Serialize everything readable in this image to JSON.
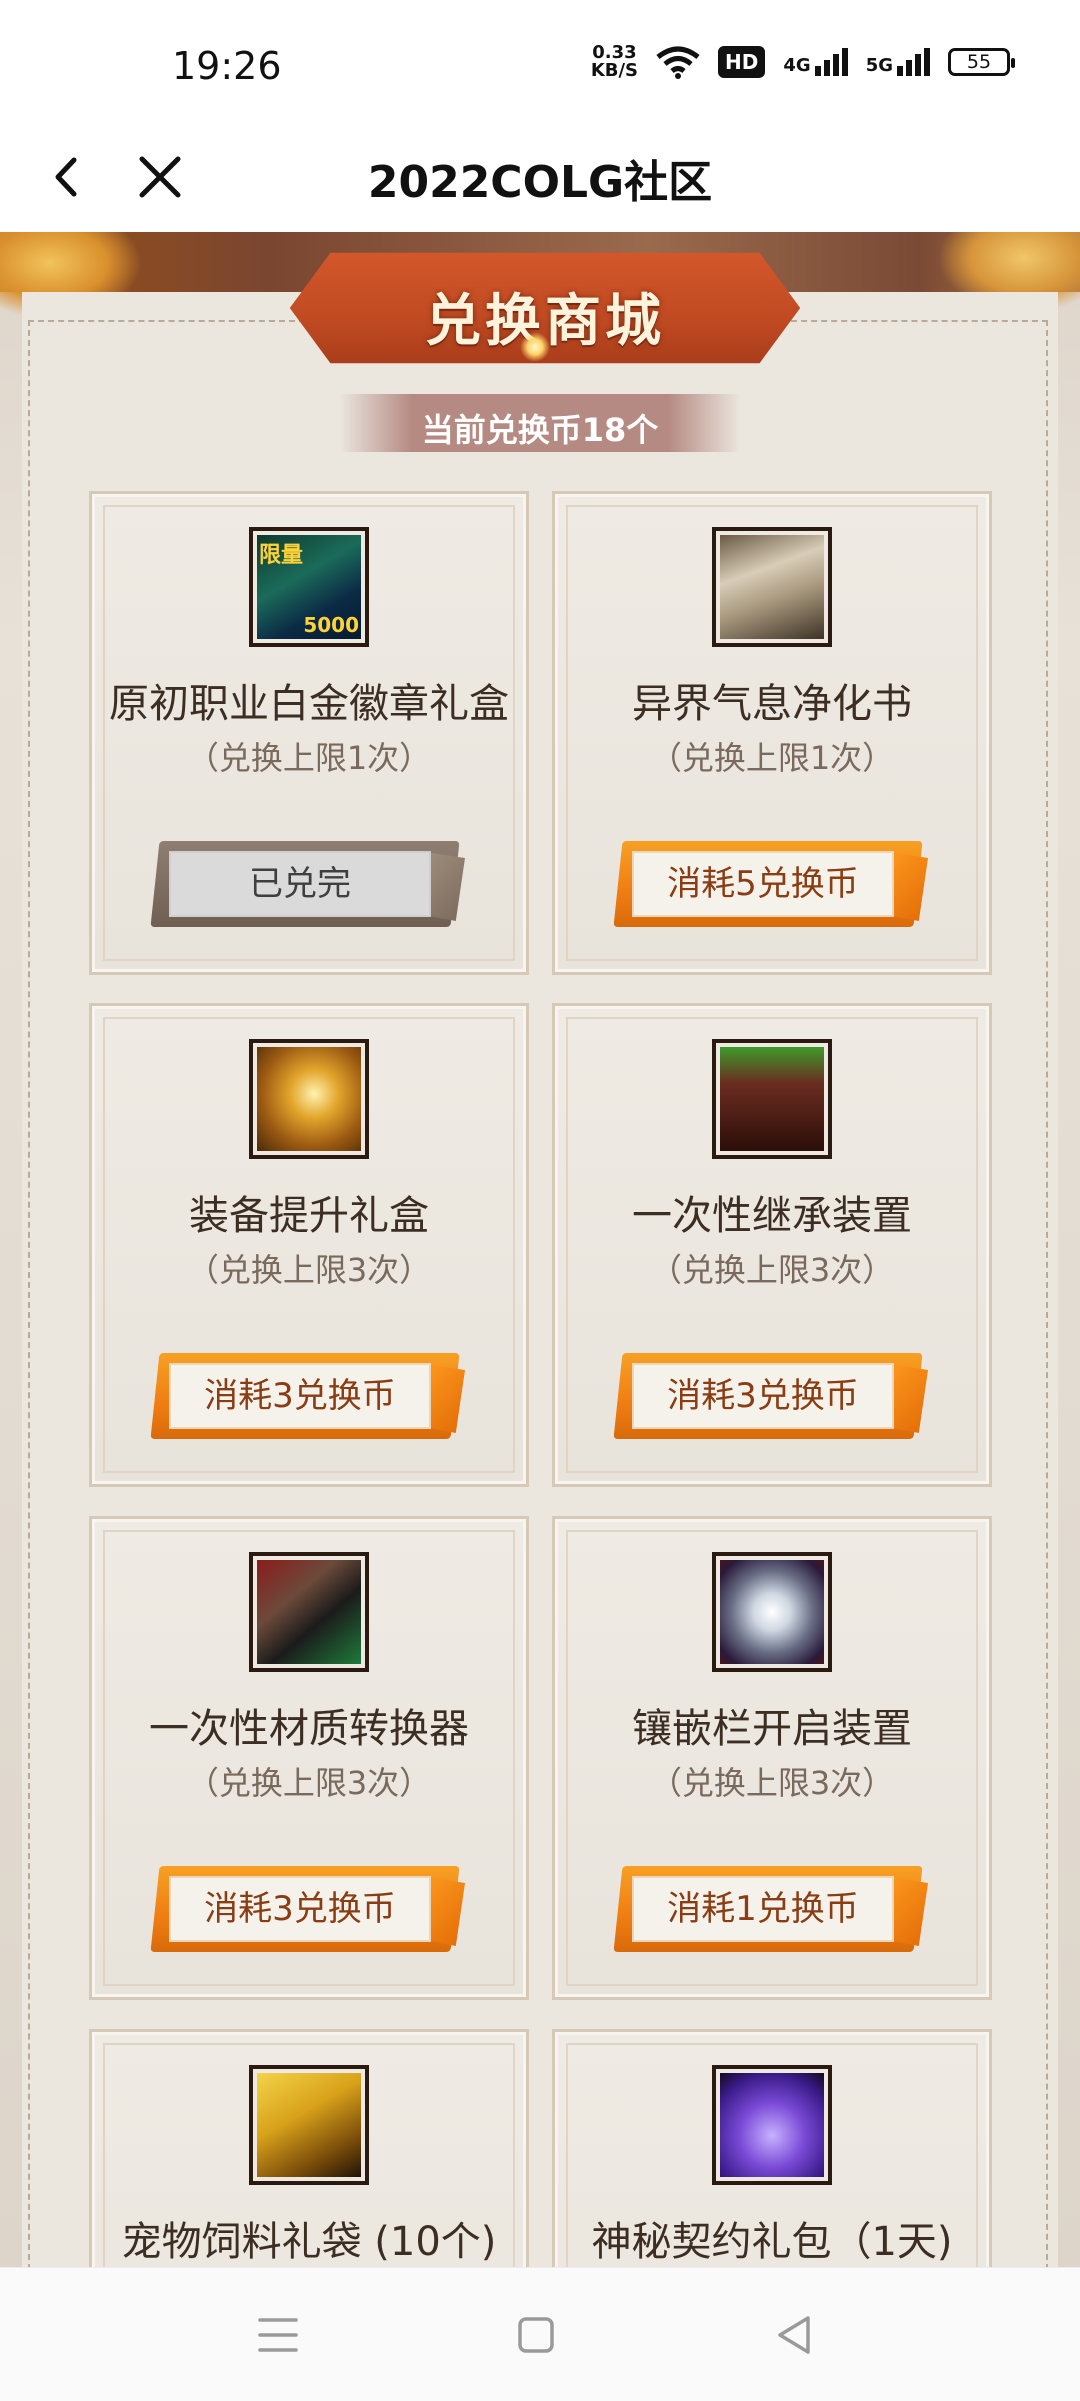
{
  "status": {
    "time": "19:26",
    "net_speed_value": "0.33",
    "net_speed_unit": "KB/S",
    "hd_badge": "HD",
    "sig1": "4G",
    "sig2": "5G",
    "battery": "55"
  },
  "nav": {
    "title": "2022COLG社区"
  },
  "header": {
    "title": "兑换商城",
    "coins": "当前兑换币18个"
  },
  "items": [
    {
      "name": "原初职业白金徽章礼盒",
      "limit": "（兑换上限1次）",
      "button": "已兑完",
      "icon_label_top": "限量",
      "icon_label_bottom": "5000"
    },
    {
      "name": "异界气息净化书",
      "limit": "（兑换上限1次）",
      "button": "消耗5兑换币"
    },
    {
      "name": "装备提升礼盒",
      "limit": "（兑换上限3次）",
      "button": "消耗3兑换币"
    },
    {
      "name": "一次性继承装置",
      "limit": "（兑换上限3次）",
      "button": "消耗3兑换币"
    },
    {
      "name": "一次性材质转换器",
      "limit": "（兑换上限3次）",
      "button": "消耗3兑换币"
    },
    {
      "name": "镶嵌栏开启装置",
      "limit": "（兑换上限3次）",
      "button": "消耗1兑换币"
    },
    {
      "name": "宠物饲料礼袋 (10个)"
    },
    {
      "name": "神秘契约礼包（1天)"
    }
  ]
}
